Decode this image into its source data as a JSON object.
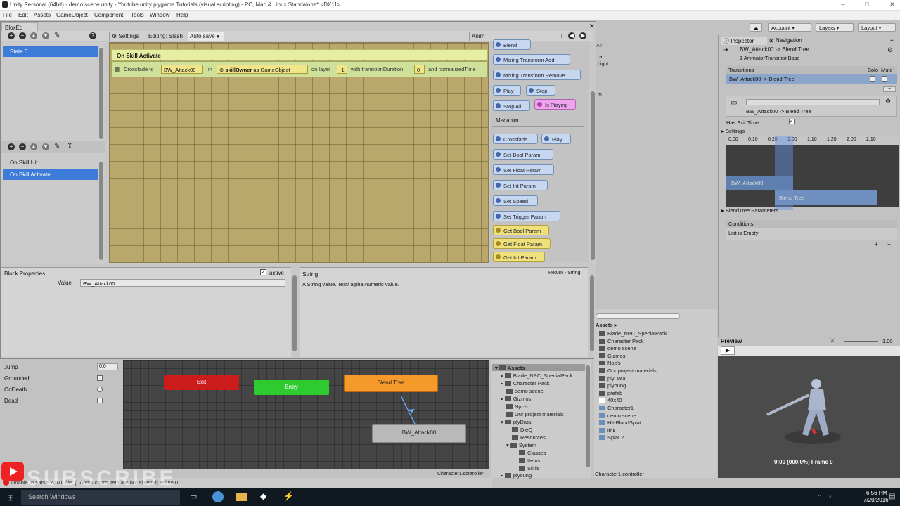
{
  "window": {
    "title": "Unity Personal (64bit) - demo scene.unity - Youtube unity plygame Tutorials (visual scripting) - PC, Mac & Linux Standalone* <DX11>"
  },
  "menu": [
    "File",
    "Edit",
    "Assets",
    "GameObject",
    "Component",
    "Tools",
    "Window",
    "Help"
  ],
  "toolbar": {
    "account": "Account",
    "layers": "Layers",
    "layout": "Layout"
  },
  "blox": {
    "tab": "BloxEd",
    "settings": "Settings",
    "editing": "Editing: Slash",
    "autosave": "Auto save",
    "anim": "Anim",
    "states": [
      "State 0"
    ],
    "events": [
      "On Skill Hit",
      "On Skill Activate"
    ],
    "event_title": "On Skill Activate",
    "block": {
      "crossfade": "Crossfade to",
      "state_value": "BW_Attack00",
      "in": "in",
      "skillowner": "skillOwner",
      "as_go": "as GameObject",
      "onlayer": "on layer",
      "layer": "-1",
      "with": "with transitionDuration",
      "dur": "0",
      "and": "and normalizedTime"
    },
    "palette": {
      "blend": "Blend",
      "mix_add": "Mixing Transform Add",
      "mix_remove": "Mixing Transform Remove",
      "play": "Play",
      "stop": "Stop",
      "stop_all": "Stop All",
      "is_playing": "Is Playing",
      "mecanim": "Mecanim",
      "crossfade": "Crossfade",
      "play2": "Play",
      "set_bool": "Set Bool Param",
      "set_float": "Set Float Param",
      "set_int": "Set Int Param",
      "set_speed": "Set Speed",
      "set_trigger": "Set Trigger Param",
      "get_bool": "Get Bool Param",
      "get_float": "Get Float Param",
      "get_int": "Get Int Param"
    },
    "props": {
      "title": "Block Properties",
      "active": "active",
      "value_label": "Value",
      "value": "BW_Attack00"
    },
    "help": {
      "title": "String",
      "ret": "Return - String",
      "desc": "A String value. Text/ alpha-numeric value."
    }
  },
  "animator": {
    "params": [
      {
        "name": "Jump",
        "val": "0.0"
      },
      {
        "name": "Grounded",
        "val": ""
      },
      {
        "name": "OnDeath",
        "val": ""
      },
      {
        "name": "Dead",
        "val": ""
      }
    ],
    "nodes": {
      "exit": "Exit",
      "entry": "Entry",
      "blend": "Blend Tree",
      "attack": "BW_Attack00"
    },
    "footer": "Character1.controller"
  },
  "hier": {
    "all": "All",
    "light": "Light",
    "ra": "ra",
    "m": "m"
  },
  "project_left": {
    "root": "Assets",
    "items": [
      "Blade_NPC_SpecialPack",
      "Character Pack",
      "demo scene",
      "Gizmos",
      "Npc's",
      "Our project materials",
      "plyData",
      "DieQ",
      "Resources",
      "System",
      "Classes",
      "Items",
      "Skills",
      "plyoung"
    ]
  },
  "project_right": {
    "crumb": "Assets",
    "items": [
      "Blade_NPC_SpecialPack",
      "Character Pack",
      "demo scene",
      "Gizmos",
      "Npc's",
      "Our project materials",
      "plyData",
      "plyoung",
      "prefab",
      "40x40",
      "Character1",
      "demo scene",
      "Hit-BloodSplat",
      "link",
      "Splat 2"
    ],
    "footer": "Character1.controller"
  },
  "inspector": {
    "tab1": "Inspector",
    "tab2": "Navigation",
    "obj": "BW_Attack00 -> Blend Tree",
    "sub": "1 AnimatorTransitionBase",
    "transitions": "Transitions",
    "solo": "Solo",
    "mute": "Mute",
    "trans_item": "BW_Attack00 -> Blend Tree",
    "name2": "BW_Attack00 -> Blend Tree",
    "has_exit": "Has Exit Time",
    "settings": "Settings",
    "ticks": [
      "0:00",
      "0:10",
      "0:20",
      "1:00",
      "1:10",
      "1:20",
      "2:00",
      "2:10"
    ],
    "clip1": "BW_Attack00",
    "clip2": "Blend Tree",
    "blendparams": "BlendTree Parameters",
    "conditions": "Conditions",
    "empty": "List is Empty"
  },
  "preview": {
    "title": "Preview",
    "speed": "1.00",
    "frame": "0:00 (000.0%) Frame 0"
  },
  "status": {
    "text": "Unable to parse YAML file: [Control characters are not allowed] at line 0",
    "overlay": "SUBSCRIBE"
  },
  "taskbar": {
    "search": "Search Windows",
    "time": "6:56 PM",
    "date": "7/20/2016"
  }
}
